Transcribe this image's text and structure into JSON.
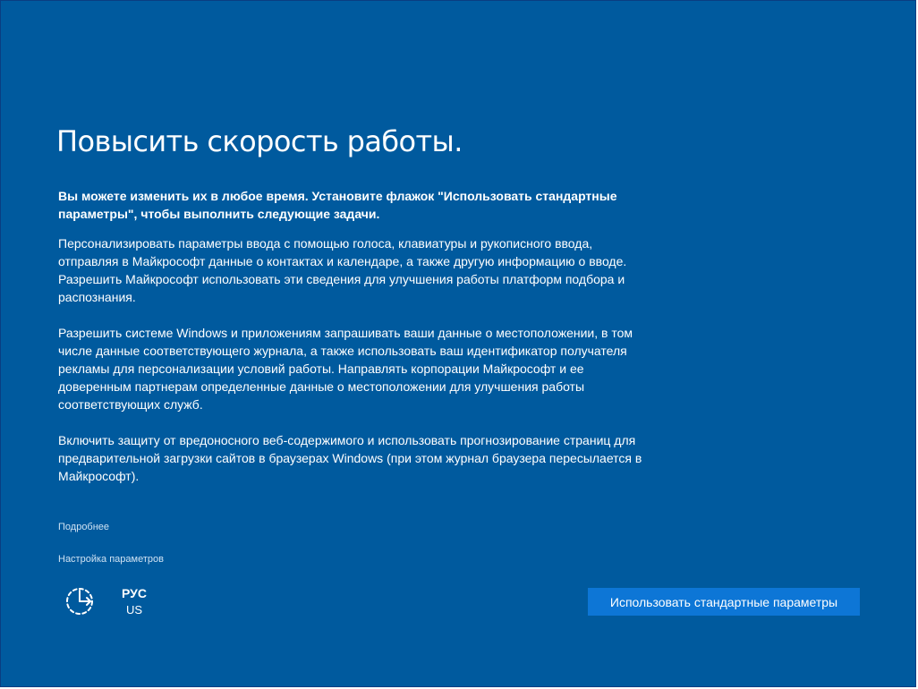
{
  "window": {
    "background_color": "#005a9e",
    "accent_color": "#0d76d6",
    "link_color": "#cfe2f3"
  },
  "page": {
    "title": "Повысить скорость работы.",
    "intro": "Вы можете изменить их в любое время. Установите флажок \"Использовать стандартные параметры\", чтобы выполнить следующие задачи.",
    "items": [
      "Персонализировать параметры ввода с помощью голоса, клавиатуры и рукописного ввода, отправляя в Майкрософт данные о контактах и календаре, а также другую информацию о вводе. Разрешить Майкрософт использовать эти сведения для улучшения работы платформ подбора и распознания.",
      "Разрешить системе Windows и приложениям запрашивать ваши данные о местоположении, в том числе данные соответствующего журнала, а также использовать ваш идентификатор получателя рекламы для персонализации условий работы. Направлять корпорации Майкрософт и ее доверенным партнерам определенные данные о местоположении для улучшения работы соответствующих служб.",
      "Включить защиту от вредоносного веб-содержимого и использовать прогнозирование страниц для предварительной загрузки сайтов в браузерах Windows (при этом журнал браузера пересылается в Майкрософт)."
    ]
  },
  "links": {
    "learn_more": "Подробнее",
    "customize": "Настройка параметров"
  },
  "footer": {
    "ease_of_access_icon": "ease-of-access-icon",
    "language_code": "РУС",
    "keyboard_layout": "US",
    "primary_button_label": "Использовать стандартные параметры"
  }
}
